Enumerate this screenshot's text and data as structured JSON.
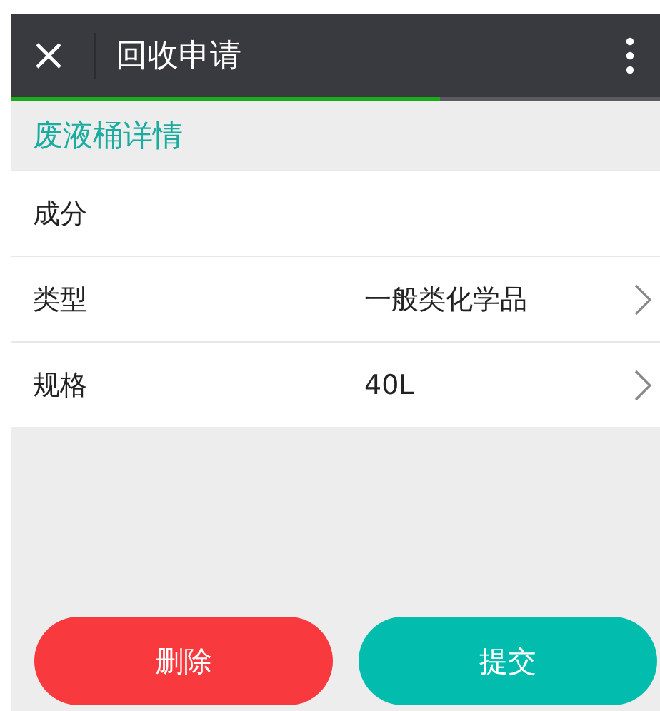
{
  "header": {
    "title": "回收申请"
  },
  "progress": {
    "level": 0.66
  },
  "section": {
    "title": "废液桶详情"
  },
  "rows": [
    {
      "kind": "plain",
      "label": "成分"
    },
    {
      "kind": "link",
      "label": "类型",
      "value": "一般类化学品"
    },
    {
      "kind": "link",
      "label": "规格",
      "value": "40L"
    }
  ],
  "buttons": [
    {
      "kind": "danger",
      "label": "删除"
    },
    {
      "kind": "primary",
      "label": "提交"
    }
  ]
}
